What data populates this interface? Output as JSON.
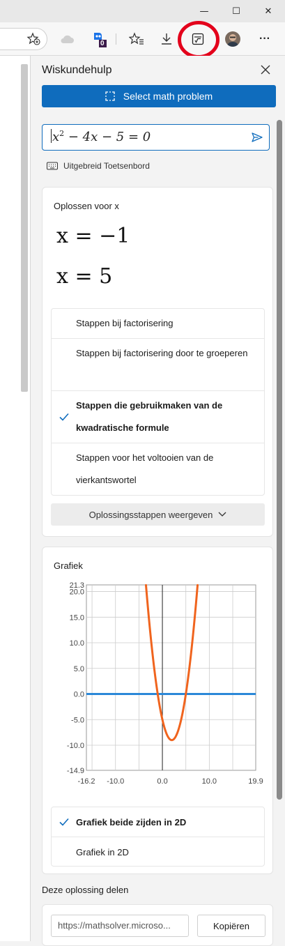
{
  "window": {
    "minimize_glyph": "—",
    "maximize_glyph": "☐",
    "close_glyph": "✕"
  },
  "toolbar": {
    "icons": [
      "add-favorite-icon",
      "cloud-icon",
      "extension-icon",
      "favorites-icon",
      "downloads-icon",
      "math-solver-icon",
      "profile-avatar",
      "more-icon"
    ],
    "extension_badge": "0",
    "more_glyph": "···",
    "highlight_color": "#e3001b"
  },
  "sidebar": {
    "title": "Wiskundehulp",
    "select_button": "Select math problem",
    "accent": "#0f6cbd"
  },
  "equation": {
    "value_parts": {
      "x1": "x",
      "exp": "2",
      "rest": " − 4x − 5 = 0"
    }
  },
  "keyboard": {
    "label": "Uitgebreid Toetsenbord"
  },
  "solve": {
    "title": "Oplossen voor x",
    "solutions": [
      "x = −1",
      "x = 5"
    ],
    "methods": [
      {
        "label": "Stappen bij factorisering",
        "selected": false
      },
      {
        "label": "Stappen bij factorisering door te groeperen",
        "selected": false
      },
      {
        "label": "Stappen die gebruikmaken van de kwadratische formule",
        "selected": true
      },
      {
        "label": "Stappen voor het voltooien van de vierkantswortel",
        "selected": false
      }
    ],
    "show_steps_button": "Oplossingsstappen weergeven"
  },
  "graph": {
    "title": "Grafiek",
    "options": [
      {
        "label": "Grafiek beide zijden in 2D",
        "selected": true
      },
      {
        "label": "Grafiek in 2D",
        "selected": false
      }
    ]
  },
  "chart_data": {
    "type": "line",
    "title": "",
    "xlabel": "",
    "ylabel": "",
    "xlim": [
      -16.2,
      19.9
    ],
    "ylim": [
      -14.9,
      21.3
    ],
    "x_ticks": [
      "-16.2",
      "-10.0",
      "0.0",
      "10.0",
      "19.9"
    ],
    "y_ticks": [
      "21.3",
      "20.0",
      "15.0",
      "10.0",
      "5.0",
      "0.0",
      "-5.0",
      "-10.0",
      "-14.9"
    ],
    "grid": true,
    "series": [
      {
        "function": "y = x^2 - 4x - 5",
        "color": "#f0641e"
      },
      {
        "function": "y = 0",
        "color": "#2b88d8"
      }
    ]
  },
  "share": {
    "title": "Deze oplossing delen",
    "url": "https://mathsolver.microso...",
    "copy_button": "Kopiëren"
  }
}
